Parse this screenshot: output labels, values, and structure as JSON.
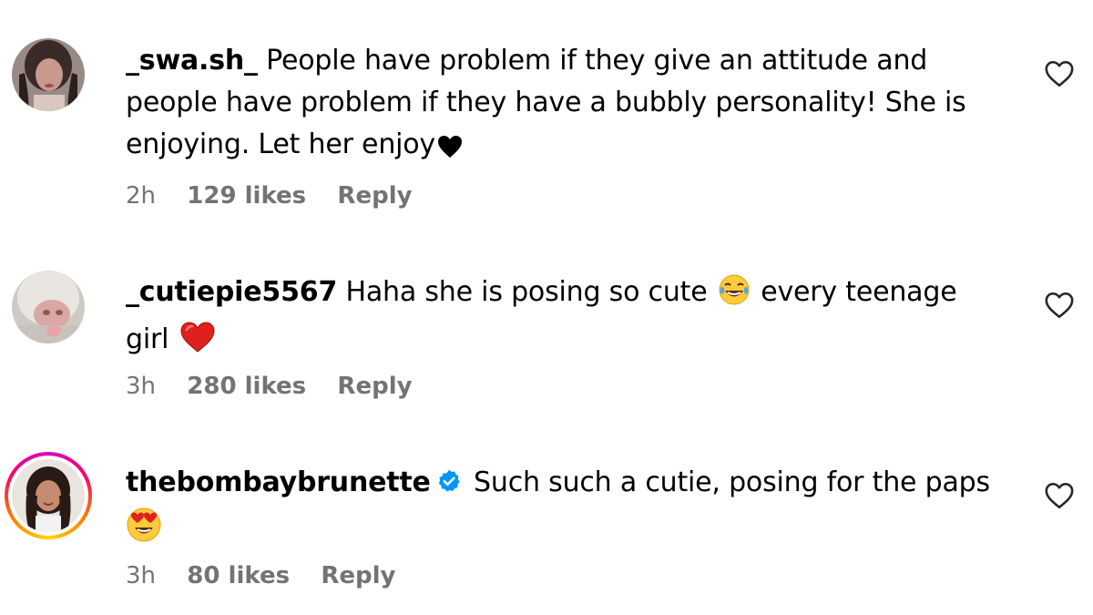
{
  "comments": [
    {
      "username": "_swa.sh_",
      "text_1": "People have problem if they give an attitude and people have problem if they have a bubbly personality! She is enjoying. Let her enjoy",
      "time": "2h",
      "likes": "129 likes",
      "reply": "Reply",
      "verified": false
    },
    {
      "username": "_cutiepie5567",
      "text_1": "Haha she is posing so cute",
      "text_2": "every teenage girl",
      "time": "3h",
      "likes": "280 likes",
      "reply": "Reply",
      "verified": false
    },
    {
      "username": "thebombaybrunette",
      "text_1": "Such such a cutie, posing for the paps",
      "time": "3h",
      "likes": "80 likes",
      "reply": "Reply",
      "verified": true
    }
  ],
  "colors": {
    "meta_gray": "#737373",
    "verified_blue": "#0095f6",
    "heart_red": "#e0201f"
  }
}
